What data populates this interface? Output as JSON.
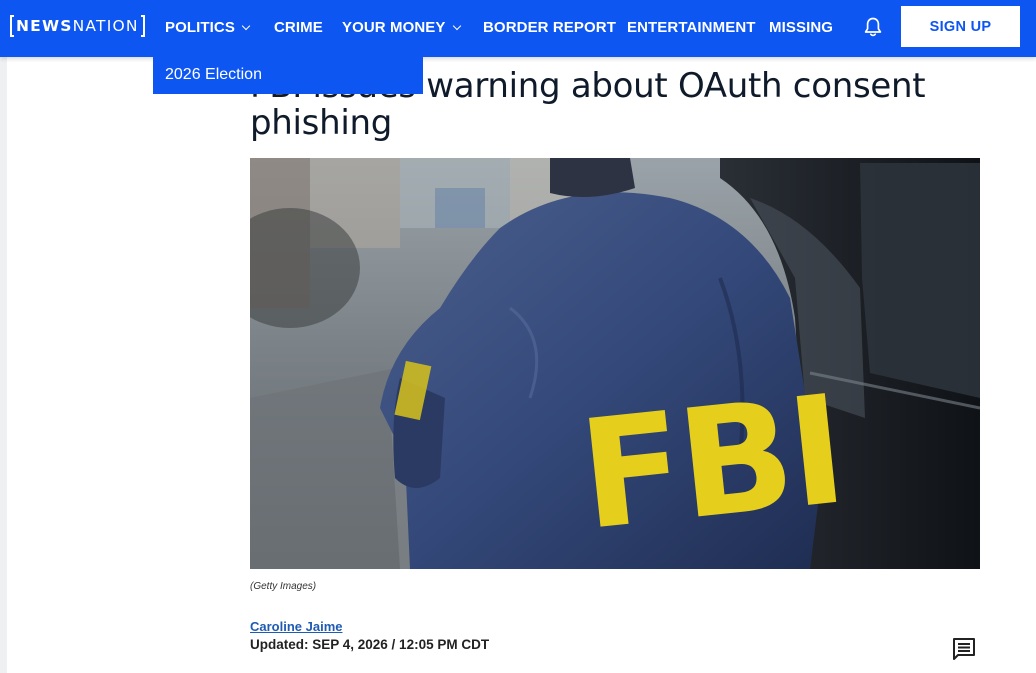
{
  "header": {
    "logo_bold": "NEWS",
    "logo_light": "NATION",
    "nav": [
      {
        "label": "POLITICS",
        "has_menu": true
      },
      {
        "label": "CRIME",
        "has_menu": false
      },
      {
        "label": "YOUR MONEY",
        "has_menu": true
      },
      {
        "label": "BORDER REPORT",
        "has_menu": false
      },
      {
        "label": "ENTERTAINMENT",
        "has_menu": false
      },
      {
        "label": "MISSING",
        "has_menu": false
      }
    ],
    "signup_label": "SIGN UP",
    "icons": {
      "notifications": "bell-icon"
    }
  },
  "dropdown": {
    "items": [
      {
        "label": "2026 Election"
      }
    ]
  },
  "article": {
    "headline": "FBI issues warning about OAuth consent phishing",
    "image_caption": "(Getty Images)",
    "image_text": "FBI",
    "author": "Caroline Jaime",
    "updated": "Updated: SEP 4, 2026 / 12:05 PM CDT",
    "icons": {
      "comments": "comment-icon"
    }
  },
  "colors": {
    "brand_blue": "#0d56f2",
    "headline": "#0f1a2b",
    "author_link": "#1f5bb3"
  }
}
